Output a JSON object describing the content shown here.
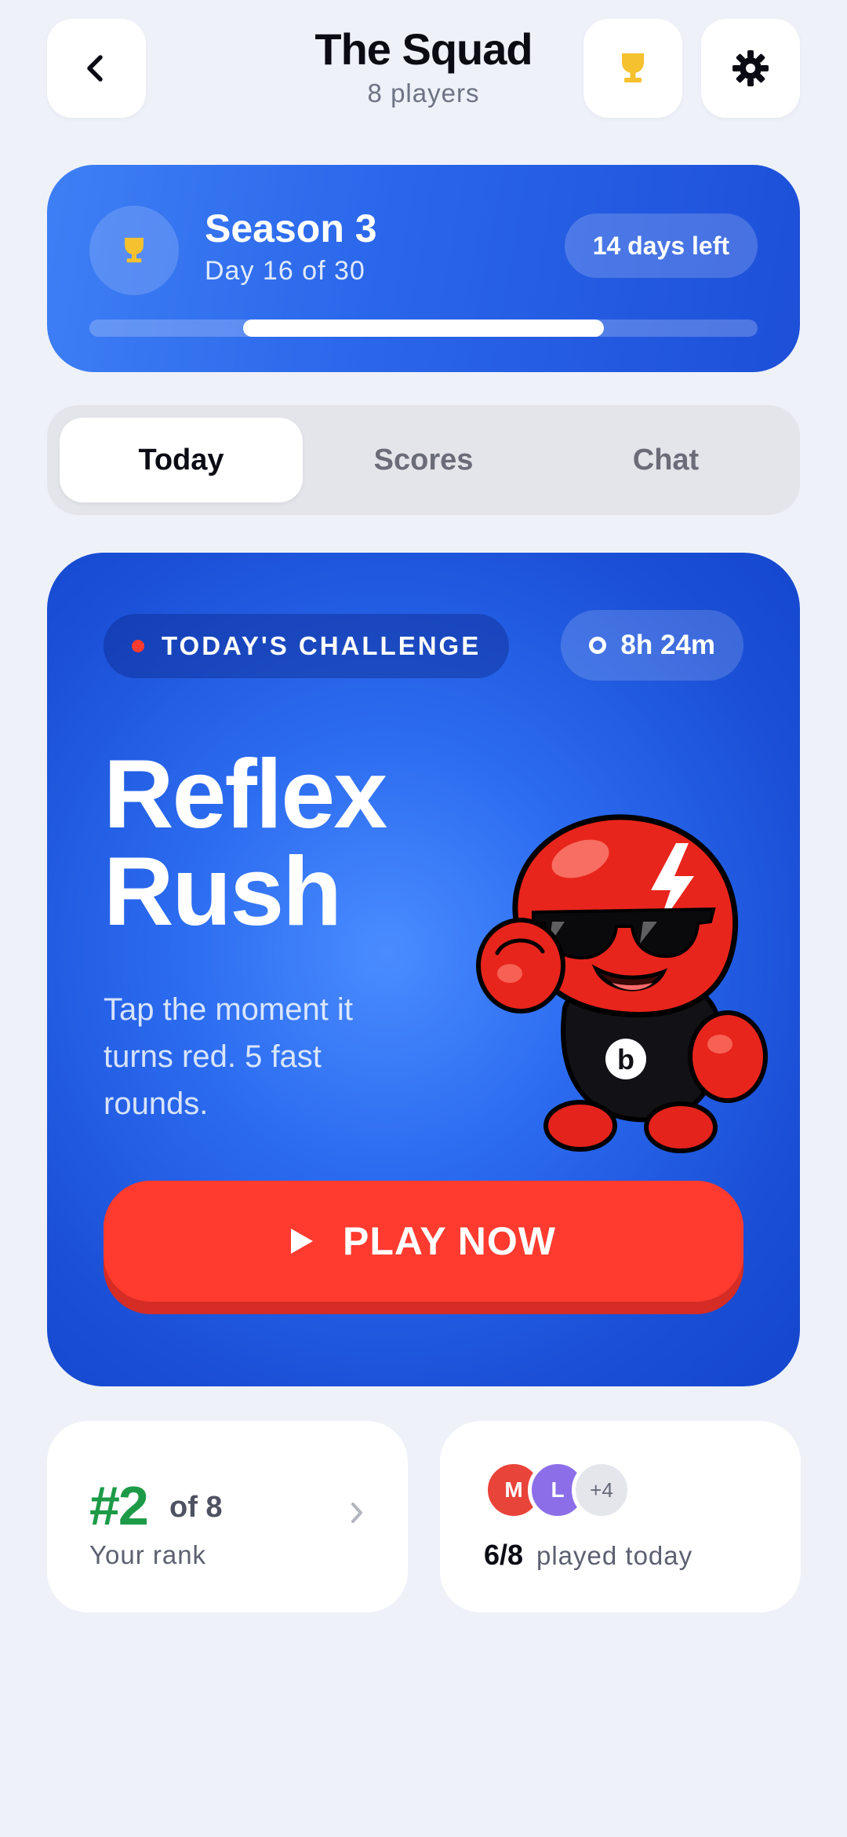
{
  "header": {
    "title": "The Squad",
    "subtitle": "8 players",
    "back_icon": "chevron-left-icon",
    "trophy_icon": "trophy-icon",
    "settings_icon": "gear-icon"
  },
  "season": {
    "title": "Season 3",
    "day_text": "Day 16 of 30",
    "days_left": "14 days left",
    "progress_start_fraction": 0.23,
    "progress_end_fraction": 0.77,
    "icon": "trophy-icon"
  },
  "tabs": [
    {
      "label": "Today",
      "active": true
    },
    {
      "label": "Scores",
      "active": false
    },
    {
      "label": "Chat",
      "active": false
    }
  ],
  "challenge": {
    "badge": "TODAY'S CHALLENGE",
    "timer": "8h 24m",
    "title_line1": "Reflex",
    "title_line2": "Rush",
    "description": "Tap the moment it turns red. 5 fast rounds.",
    "play_label": "PLAY NOW",
    "mascot": "red-boxing-mascot-with-sunglasses",
    "mascot_shirt_letter": "b"
  },
  "rank": {
    "value": "#2",
    "of_text": "of 8",
    "label": "Your rank"
  },
  "played": {
    "avatars": [
      "M",
      "L"
    ],
    "more": "+4",
    "count": "6/8",
    "label": "played today"
  },
  "colors": {
    "background": "#eef1f8",
    "primary_blue": "#2a66ea",
    "play_red": "#ff3b30",
    "rank_green": "#1d9a47",
    "trophy_gold": "#f5c12e"
  }
}
